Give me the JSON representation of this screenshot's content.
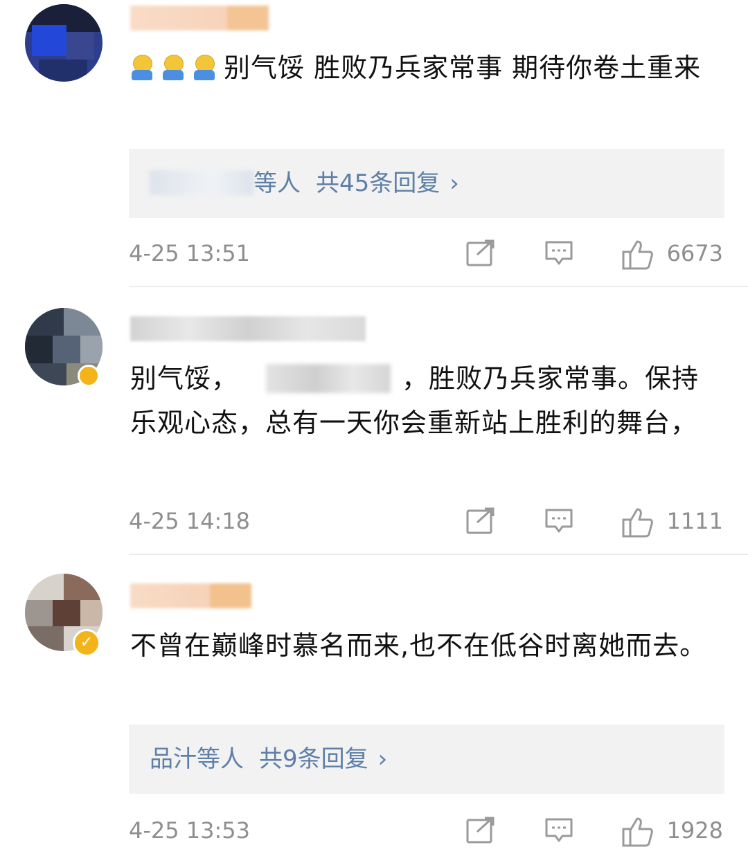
{
  "comments": [
    {
      "text_suffix": "别气馁 胜败乃兵家常事 期待你卷土重来",
      "reply_summary": {
        "users_visible": "等人",
        "count_text": "共45条回复"
      },
      "time": "4-25 13:51",
      "likes": "6673"
    },
    {
      "text_part1": "别气馁，",
      "text_part2": "，胜败乃兵家常事。保持乐观心态，总有一天你会重新站上胜利的舞台，",
      "time": "4-25 14:18",
      "likes": "1111"
    },
    {
      "text": "不曾在巅峰时慕名而来,也不在低谷时离她而去。",
      "reply_summary": {
        "users_visible": "品汁等人",
        "count_text": "共9条回复"
      },
      "time": "4-25 13:53",
      "likes": "1928"
    }
  ],
  "icons": {
    "share": "share-icon",
    "comment": "comment-icon",
    "like": "thumbs-up-icon",
    "chevron": "chevron-right-icon",
    "emoji": "smiley-emoji-icon",
    "verified": "verified-badge-icon"
  },
  "colors": {
    "link": "#5d7ea7",
    "meta": "#8e8e8e",
    "text": "#111111",
    "reply_bg": "#f2f2f2",
    "badge": "#f3b41a"
  }
}
